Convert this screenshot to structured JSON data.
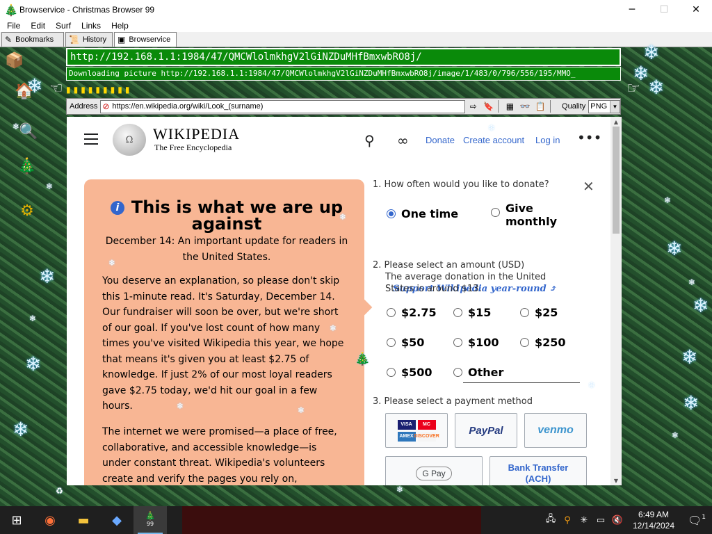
{
  "window": {
    "title": "Browservice - Christmas Browser 99",
    "minimize": "─",
    "maximize": "☐",
    "close": "✕"
  },
  "menu": [
    "File",
    "Edit",
    "Surf",
    "Links",
    "Help"
  ],
  "tabs": [
    {
      "label": "Bookmarks",
      "icon": "bookmark-icon"
    },
    {
      "label": "History",
      "icon": "history-icon"
    },
    {
      "label": "Browservice",
      "icon": "browservice-icon"
    }
  ],
  "urlbar": {
    "text": "http://192.168.1.1:1984/47/QMCWlolmkhgV2lGiNZDuMHfBmxwbRO8j/",
    "status": "Downloading picture http://192.168.1.1:1984/47/QMCWlolmkhgV2lGiNZDuMHfBmxwbRO8j/image/1/483/0/796/556/195/MMO_"
  },
  "addressbar": {
    "label": "Address",
    "url": "https://en.wikipedia.org/wiki/Look_(surname)",
    "quality_label": "Quality",
    "quality_value": "PNG"
  },
  "wikipedia": {
    "wordmark": "WIKIPEDIA",
    "tagline": "The Free Encyclopedia",
    "donate": "Donate",
    "create_account": "Create account",
    "login": "Log in"
  },
  "fundraiser": {
    "heading": "This is what we are up against",
    "subheading": "December 14: An important update for readers in the United States.",
    "para1": "You deserve an explanation, so please don't skip this 1-minute read. It's Saturday, December 14. Our fundraiser will soon be over, but we're short of our goal. If you've lost count of how many times you've visited Wikipedia this year, we hope that means it's given you at least $2.75 of knowledge. If just 2% of our most loyal readers gave $2.75 today, we'd hit our goal in a few hours.",
    "para2": "The internet we were promised—a place of free, collaborative, and accessible knowledge—is under constant threat. Wikipedia's volunteers create and verify the pages you rely on,"
  },
  "donate_form": {
    "q1": "1. How often would you like to donate?",
    "freq_one": "One time",
    "freq_monthly_1": "Give",
    "freq_monthly_2": "monthly",
    "support_link": "Support Wikipedia year-round",
    "q2": "2. Please select an amount (USD)",
    "q2_note_1": "The average donation in the United",
    "q2_note_2": "States is around $13.",
    "amounts": [
      "$2.75",
      "$15",
      "$25",
      "$50",
      "$100",
      "$250",
      "$500",
      "Other"
    ],
    "q3": "3. Please select a payment method",
    "pay_cards": [
      "VISA",
      "MC",
      "AMEX",
      "DISCOVER"
    ],
    "pay_paypal": "PayPal",
    "pay_venmo": "venmo",
    "pay_gpay": "G Pay",
    "pay_bank_1": "Bank Transfer",
    "pay_bank_2": "(ACH)"
  },
  "taskbar": {
    "time": "6:49 AM",
    "date": "12/14/2024",
    "notification_count": "1",
    "tray_badge": "99"
  },
  "colors": {
    "wiki_link": "#3366cc",
    "fund_bg": "#f8b694",
    "urlbar_bg": "#0a8a0a"
  }
}
